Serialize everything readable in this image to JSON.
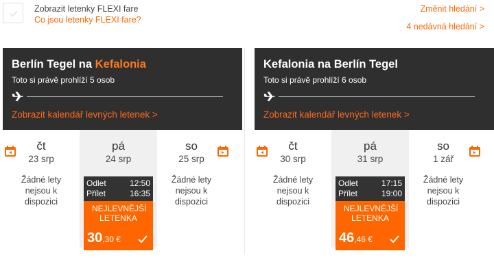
{
  "flexi": {
    "title": "Zobrazit letenky FLEXI fare",
    "link": "Co jsou letenky FLEXI fare?"
  },
  "top_links": {
    "change_search": "Změnit hledání >",
    "recent_searches": "4 nedávná hledání >"
  },
  "colors": {
    "accent": "#ff6600",
    "header_bg": "#2f2f2f"
  },
  "outbound": {
    "from": "Berlín Tegel na",
    "to": "Kefalonia",
    "viewers": "Toto si právě prohlíží 5 osob",
    "calendar_link": "Zobrazit kalendář levných letenek >",
    "days": [
      {
        "weekday": "čt",
        "date": "23 srp",
        "none": "Žádné lety nejsou k dispozici"
      },
      {
        "weekday": "pá",
        "date": "24 srp",
        "depart_label": "Odlet",
        "depart": "12:50",
        "arrive_label": "Přílet",
        "arrive": "16:35",
        "cheapest": "NEJLEVNĚJŠÍ LETENKA",
        "price_int": "30",
        "price_dec": ",30 €"
      },
      {
        "weekday": "so",
        "date": "25 srp",
        "none": "Žádné lety nejsou k dispozici"
      }
    ]
  },
  "return": {
    "from": "Kefalonia na Berlín Tegel",
    "viewers": "Toto si právě prohlíží 6 osob",
    "calendar_link": "Zobrazit kalendář levných letenek >",
    "days": [
      {
        "weekday": "čt",
        "date": "30 srp",
        "none": "Žádné lety nejsou k dispozici"
      },
      {
        "weekday": "pá",
        "date": "31 srp",
        "depart_label": "Odlet",
        "depart": "17:15",
        "arrive_label": "Přílet",
        "arrive": "19:00",
        "cheapest": "NEJLEVNĚJŠÍ LETENKA",
        "price_int": "46",
        "price_dec": ",46 €"
      },
      {
        "weekday": "so",
        "date": "1 zář",
        "none": "Žádné lety nejsou k dispozici"
      }
    ]
  },
  "icons": {
    "checkbox": "check-icon",
    "plane": "plane-icon",
    "calendar": "calendar-prev-next-icon"
  }
}
